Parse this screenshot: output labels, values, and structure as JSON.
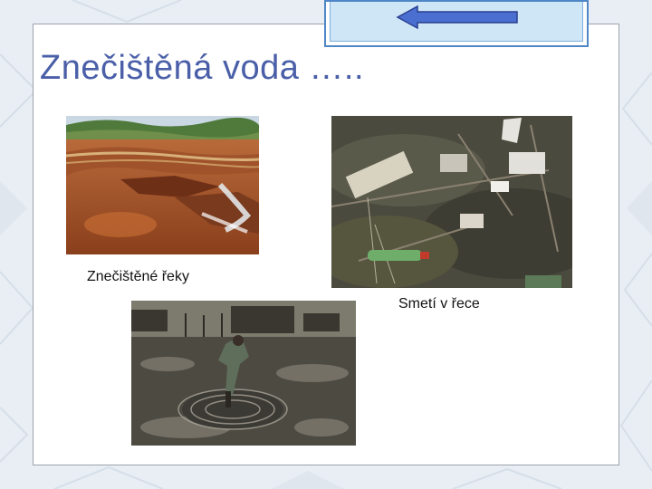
{
  "slide": {
    "title": "Znečištěná voda …..",
    "captions": {
      "rivers": "Znečištěné řeky",
      "trash": "Smetí v řece"
    }
  },
  "navigation": {
    "back_icon": "left-arrow-icon"
  },
  "colors": {
    "title": "#4a5fa8",
    "nav_border": "#4f86c6",
    "nav_fill": "#cfe6f6",
    "arrow": "#4a6fd0",
    "background": "#e9eef4"
  }
}
